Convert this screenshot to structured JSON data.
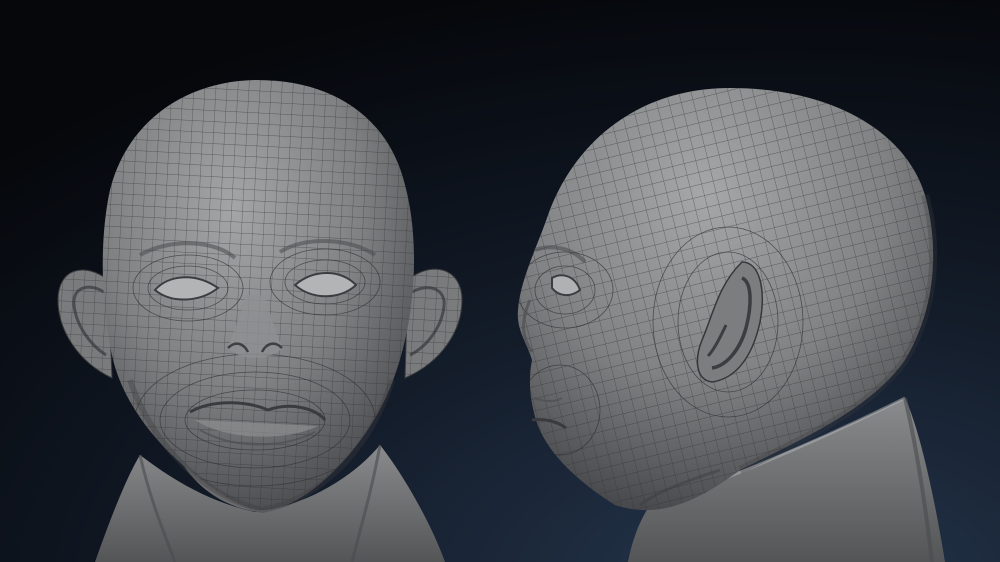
{
  "scene": {
    "background_top": "#05070b",
    "background_bottom": "#1e2c3f",
    "mesh_fill": "#7d7e80",
    "mesh_highlight": "#a2a3a5",
    "mesh_shadow": "#3c3d40",
    "wire_color": "#2f3033",
    "views": [
      "front",
      "side-profile"
    ]
  }
}
